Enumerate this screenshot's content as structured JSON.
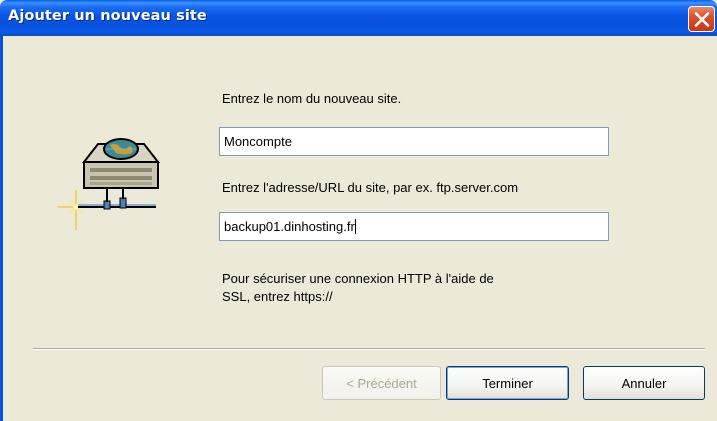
{
  "window": {
    "title": "Ajouter un nouveau site"
  },
  "form": {
    "site_name_label": "Entrez le nom du nouveau site.",
    "site_name_value": "Moncompte",
    "url_label": "Entrez l'adresse/URL du site, par ex. ftp.server.com",
    "url_value": "backup01.dinhosting.fr",
    "ssl_hint_line1": "Pour sécuriser une connexion HTTP à l'aide de",
    "ssl_hint_line2": "SSL, entrez https://"
  },
  "buttons": {
    "previous": "< Précédent",
    "finish": "Terminer",
    "cancel": "Annuler"
  },
  "icons": {
    "close": "close-icon",
    "site": "network-server-icon"
  },
  "colors": {
    "titlebar": "#0954e3",
    "close": "#d8502c",
    "dialog_bg": "#ece9d8"
  }
}
